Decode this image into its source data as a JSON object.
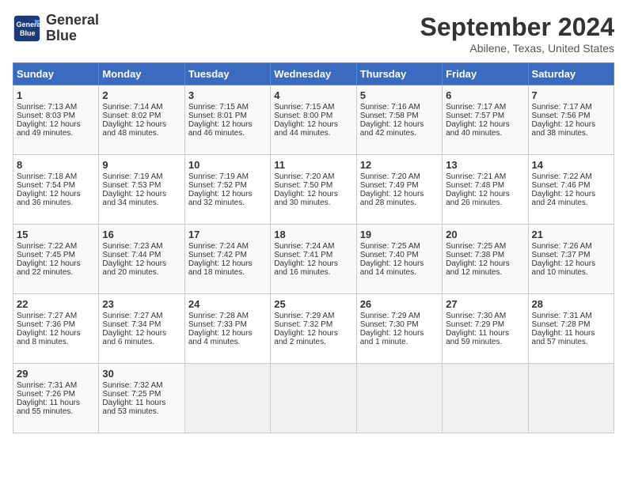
{
  "header": {
    "logo_line1": "General",
    "logo_line2": "Blue",
    "month_year": "September 2024",
    "location": "Abilene, Texas, United States"
  },
  "days_of_week": [
    "Sunday",
    "Monday",
    "Tuesday",
    "Wednesday",
    "Thursday",
    "Friday",
    "Saturday"
  ],
  "weeks": [
    [
      {
        "day": "1",
        "lines": [
          "Sunrise: 7:13 AM",
          "Sunset: 8:03 PM",
          "Daylight: 12 hours",
          "and 49 minutes."
        ]
      },
      {
        "day": "2",
        "lines": [
          "Sunrise: 7:14 AM",
          "Sunset: 8:02 PM",
          "Daylight: 12 hours",
          "and 48 minutes."
        ]
      },
      {
        "day": "3",
        "lines": [
          "Sunrise: 7:15 AM",
          "Sunset: 8:01 PM",
          "Daylight: 12 hours",
          "and 46 minutes."
        ]
      },
      {
        "day": "4",
        "lines": [
          "Sunrise: 7:15 AM",
          "Sunset: 8:00 PM",
          "Daylight: 12 hours",
          "and 44 minutes."
        ]
      },
      {
        "day": "5",
        "lines": [
          "Sunrise: 7:16 AM",
          "Sunset: 7:58 PM",
          "Daylight: 12 hours",
          "and 42 minutes."
        ]
      },
      {
        "day": "6",
        "lines": [
          "Sunrise: 7:17 AM",
          "Sunset: 7:57 PM",
          "Daylight: 12 hours",
          "and 40 minutes."
        ]
      },
      {
        "day": "7",
        "lines": [
          "Sunrise: 7:17 AM",
          "Sunset: 7:56 PM",
          "Daylight: 12 hours",
          "and 38 minutes."
        ]
      }
    ],
    [
      {
        "day": "8",
        "lines": [
          "Sunrise: 7:18 AM",
          "Sunset: 7:54 PM",
          "Daylight: 12 hours",
          "and 36 minutes."
        ]
      },
      {
        "day": "9",
        "lines": [
          "Sunrise: 7:19 AM",
          "Sunset: 7:53 PM",
          "Daylight: 12 hours",
          "and 34 minutes."
        ]
      },
      {
        "day": "10",
        "lines": [
          "Sunrise: 7:19 AM",
          "Sunset: 7:52 PM",
          "Daylight: 12 hours",
          "and 32 minutes."
        ]
      },
      {
        "day": "11",
        "lines": [
          "Sunrise: 7:20 AM",
          "Sunset: 7:50 PM",
          "Daylight: 12 hours",
          "and 30 minutes."
        ]
      },
      {
        "day": "12",
        "lines": [
          "Sunrise: 7:20 AM",
          "Sunset: 7:49 PM",
          "Daylight: 12 hours",
          "and 28 minutes."
        ]
      },
      {
        "day": "13",
        "lines": [
          "Sunrise: 7:21 AM",
          "Sunset: 7:48 PM",
          "Daylight: 12 hours",
          "and 26 minutes."
        ]
      },
      {
        "day": "14",
        "lines": [
          "Sunrise: 7:22 AM",
          "Sunset: 7:46 PM",
          "Daylight: 12 hours",
          "and 24 minutes."
        ]
      }
    ],
    [
      {
        "day": "15",
        "lines": [
          "Sunrise: 7:22 AM",
          "Sunset: 7:45 PM",
          "Daylight: 12 hours",
          "and 22 minutes."
        ]
      },
      {
        "day": "16",
        "lines": [
          "Sunrise: 7:23 AM",
          "Sunset: 7:44 PM",
          "Daylight: 12 hours",
          "and 20 minutes."
        ]
      },
      {
        "day": "17",
        "lines": [
          "Sunrise: 7:24 AM",
          "Sunset: 7:42 PM",
          "Daylight: 12 hours",
          "and 18 minutes."
        ]
      },
      {
        "day": "18",
        "lines": [
          "Sunrise: 7:24 AM",
          "Sunset: 7:41 PM",
          "Daylight: 12 hours",
          "and 16 minutes."
        ]
      },
      {
        "day": "19",
        "lines": [
          "Sunrise: 7:25 AM",
          "Sunset: 7:40 PM",
          "Daylight: 12 hours",
          "and 14 minutes."
        ]
      },
      {
        "day": "20",
        "lines": [
          "Sunrise: 7:25 AM",
          "Sunset: 7:38 PM",
          "Daylight: 12 hours",
          "and 12 minutes."
        ]
      },
      {
        "day": "21",
        "lines": [
          "Sunrise: 7:26 AM",
          "Sunset: 7:37 PM",
          "Daylight: 12 hours",
          "and 10 minutes."
        ]
      }
    ],
    [
      {
        "day": "22",
        "lines": [
          "Sunrise: 7:27 AM",
          "Sunset: 7:36 PM",
          "Daylight: 12 hours",
          "and 8 minutes."
        ]
      },
      {
        "day": "23",
        "lines": [
          "Sunrise: 7:27 AM",
          "Sunset: 7:34 PM",
          "Daylight: 12 hours",
          "and 6 minutes."
        ]
      },
      {
        "day": "24",
        "lines": [
          "Sunrise: 7:28 AM",
          "Sunset: 7:33 PM",
          "Daylight: 12 hours",
          "and 4 minutes."
        ]
      },
      {
        "day": "25",
        "lines": [
          "Sunrise: 7:29 AM",
          "Sunset: 7:32 PM",
          "Daylight: 12 hours",
          "and 2 minutes."
        ]
      },
      {
        "day": "26",
        "lines": [
          "Sunrise: 7:29 AM",
          "Sunset: 7:30 PM",
          "Daylight: 12 hours",
          "and 1 minute."
        ]
      },
      {
        "day": "27",
        "lines": [
          "Sunrise: 7:30 AM",
          "Sunset: 7:29 PM",
          "Daylight: 11 hours",
          "and 59 minutes."
        ]
      },
      {
        "day": "28",
        "lines": [
          "Sunrise: 7:31 AM",
          "Sunset: 7:28 PM",
          "Daylight: 11 hours",
          "and 57 minutes."
        ]
      }
    ],
    [
      {
        "day": "29",
        "lines": [
          "Sunrise: 7:31 AM",
          "Sunset: 7:26 PM",
          "Daylight: 11 hours",
          "and 55 minutes."
        ]
      },
      {
        "day": "30",
        "lines": [
          "Sunrise: 7:32 AM",
          "Sunset: 7:25 PM",
          "Daylight: 11 hours",
          "and 53 minutes."
        ]
      },
      {
        "day": "",
        "lines": []
      },
      {
        "day": "",
        "lines": []
      },
      {
        "day": "",
        "lines": []
      },
      {
        "day": "",
        "lines": []
      },
      {
        "day": "",
        "lines": []
      }
    ]
  ]
}
